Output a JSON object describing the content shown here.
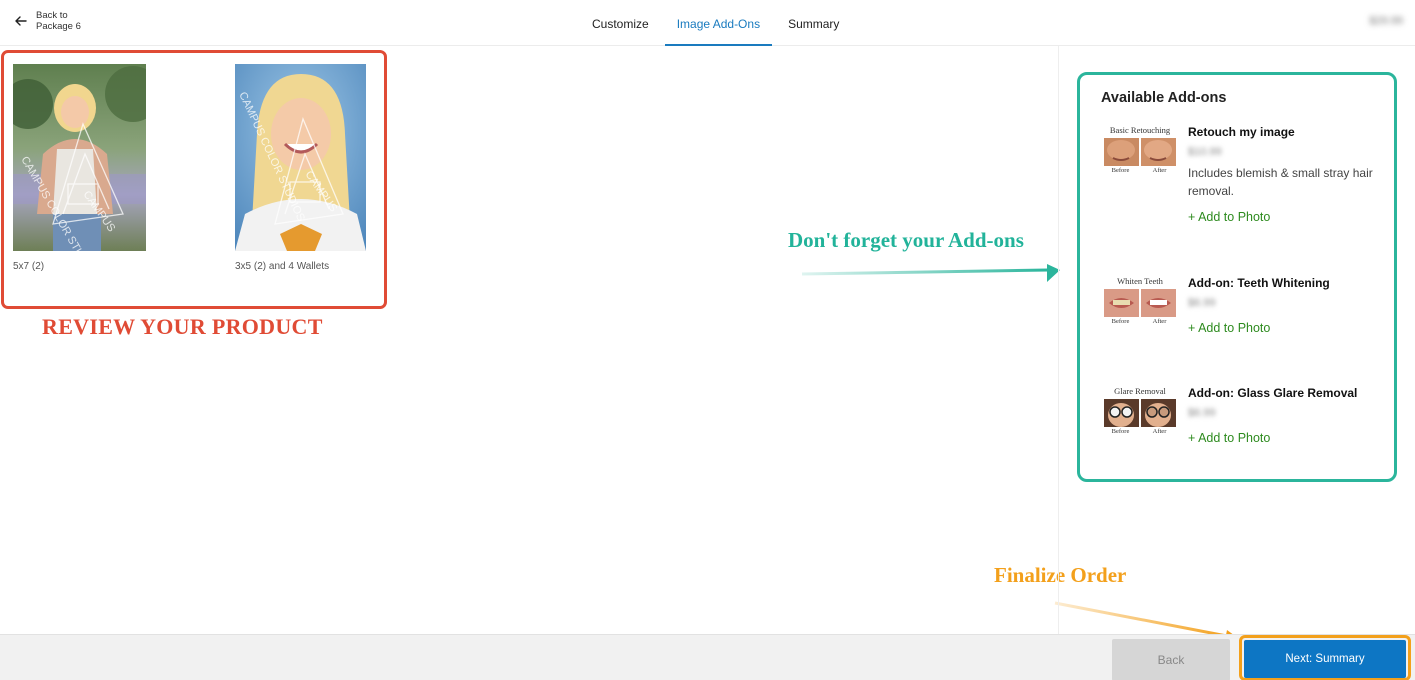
{
  "header": {
    "back_line1": "Back to",
    "back_line2": "Package 6",
    "tabs": [
      {
        "label": "Customize"
      },
      {
        "label": "Image Add-Ons",
        "active": true
      },
      {
        "label": "Summary"
      }
    ],
    "total_price": "$29.99"
  },
  "products": [
    {
      "caption": "5x7 (2)",
      "watermark": "CAMPUS COLOR STUDIOS"
    },
    {
      "caption": "3x5 (2) and 4 Wallets",
      "watermark": "CAMPUS COLOR STUDIOS"
    }
  ],
  "annotations": {
    "review": "REVIEW YOUR PRODUCT",
    "addons": "Don't forget your Add-ons",
    "finalize": "Finalize Order"
  },
  "addons_panel": {
    "title": "Available Add-ons",
    "items": [
      {
        "thumb_label": "Basic Retouching",
        "name": "Retouch my image",
        "price": "$10.99",
        "description": "Includes blemish & small stray hair removal.",
        "add_label": "+ Add to Photo",
        "before": "Before",
        "after": "After"
      },
      {
        "thumb_label": "Whiten Teeth",
        "name": "Add-on: Teeth Whitening",
        "price": "$6.99",
        "description": "",
        "add_label": "+ Add to Photo",
        "before": "Before",
        "after": "After"
      },
      {
        "thumb_label": "Glare Removal",
        "name": "Add-on: Glass Glare Removal",
        "price": "$6.99",
        "description": "",
        "add_label": "+ Add to Photo",
        "before": "Before",
        "after": "After"
      }
    ]
  },
  "footer": {
    "back_label": "Back",
    "next_label": "Next: Summary"
  },
  "colors": {
    "accent_blue": "#0d76c4",
    "review_red": "#e04b35",
    "addons_teal": "#2bb59c",
    "finalize_orange": "#f3a01b",
    "add_link_green": "#2e8b1f"
  }
}
